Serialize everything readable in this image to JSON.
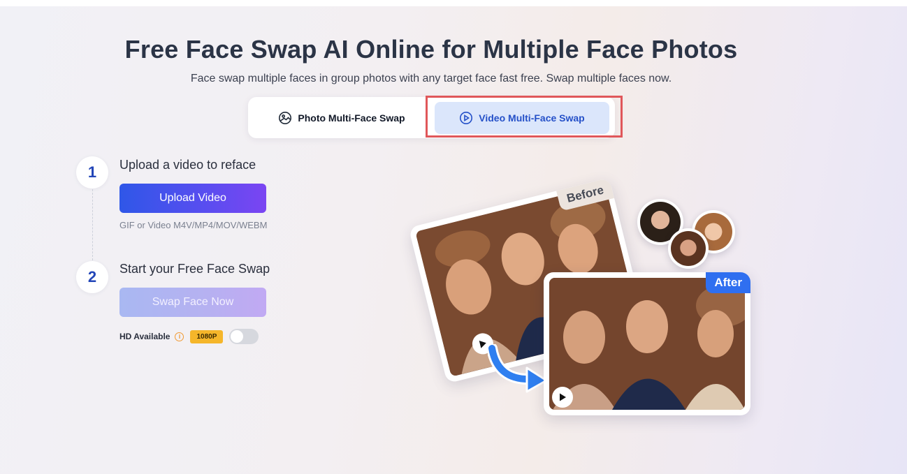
{
  "header": {
    "title": "Free Face Swap AI Online for Multiple Face Photos",
    "subtitle": "Face swap multiple faces in group photos with any target face fast free. Swap multiple faces now."
  },
  "tabs": [
    {
      "label": "Photo Multi-Face Swap",
      "icon": "image-icon",
      "active": false
    },
    {
      "label": "Video Multi-Face Swap",
      "icon": "play-circle-icon",
      "active": true
    }
  ],
  "steps": [
    {
      "number": "1",
      "title": "Upload a video to reface",
      "button_label": "Upload Video",
      "hint": "GIF or Video M4V/MP4/MOV/WEBM"
    },
    {
      "number": "2",
      "title": "Start your Free Face Swap",
      "button_label": "Swap Face Now"
    }
  ],
  "hd": {
    "label": "HD Available",
    "info_icon": "info-icon",
    "badge": "1080P",
    "toggle_on": false
  },
  "illustration": {
    "before_label": "Before",
    "after_label": "After"
  },
  "colors": {
    "primary": "#2f57e8",
    "accent_purple": "#7b45f2",
    "active_tab_bg": "#dbe6fb",
    "active_tab_text": "#2450c8",
    "badge": "#f5b62a",
    "highlight": "#e0575a"
  }
}
